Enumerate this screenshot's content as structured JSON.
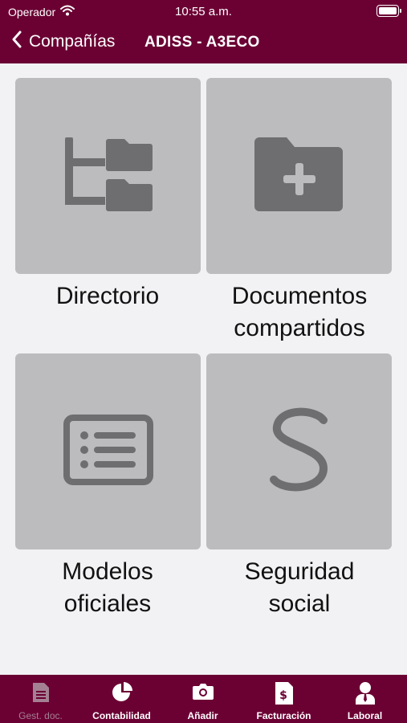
{
  "status_bar": {
    "carrier": "Operador",
    "time": "10:55 a.m."
  },
  "nav": {
    "back_label": "Compañías",
    "title": "ADISS - A3ECO"
  },
  "tiles": [
    {
      "label_line1": "Directorio",
      "label_line2": "",
      "icon": "folder-tree-icon"
    },
    {
      "label_line1": "Documentos",
      "label_line2": "compartidos",
      "icon": "folder-plus-icon"
    },
    {
      "label_line1": "Modelos",
      "label_line2": "oficiales",
      "icon": "list-card-icon"
    },
    {
      "label_line1": "Seguridad",
      "label_line2": "social",
      "icon": "letter-s-icon"
    }
  ],
  "tabbar": {
    "items": [
      {
        "label": "Gest. doc.",
        "icon": "document-icon",
        "active": false
      },
      {
        "label": "Contabilidad",
        "icon": "pie-chart-icon",
        "active": true
      },
      {
        "label": "Añadir",
        "icon": "camera-icon",
        "active": true
      },
      {
        "label": "Facturación",
        "icon": "invoice-icon",
        "active": true
      },
      {
        "label": "Laboral",
        "icon": "person-icon",
        "active": true
      }
    ]
  },
  "colors": {
    "brand": "#6b0033",
    "tile_bg": "#bcbcbe",
    "icon_gray": "#6e6e70",
    "background": "#f2f2f4"
  }
}
